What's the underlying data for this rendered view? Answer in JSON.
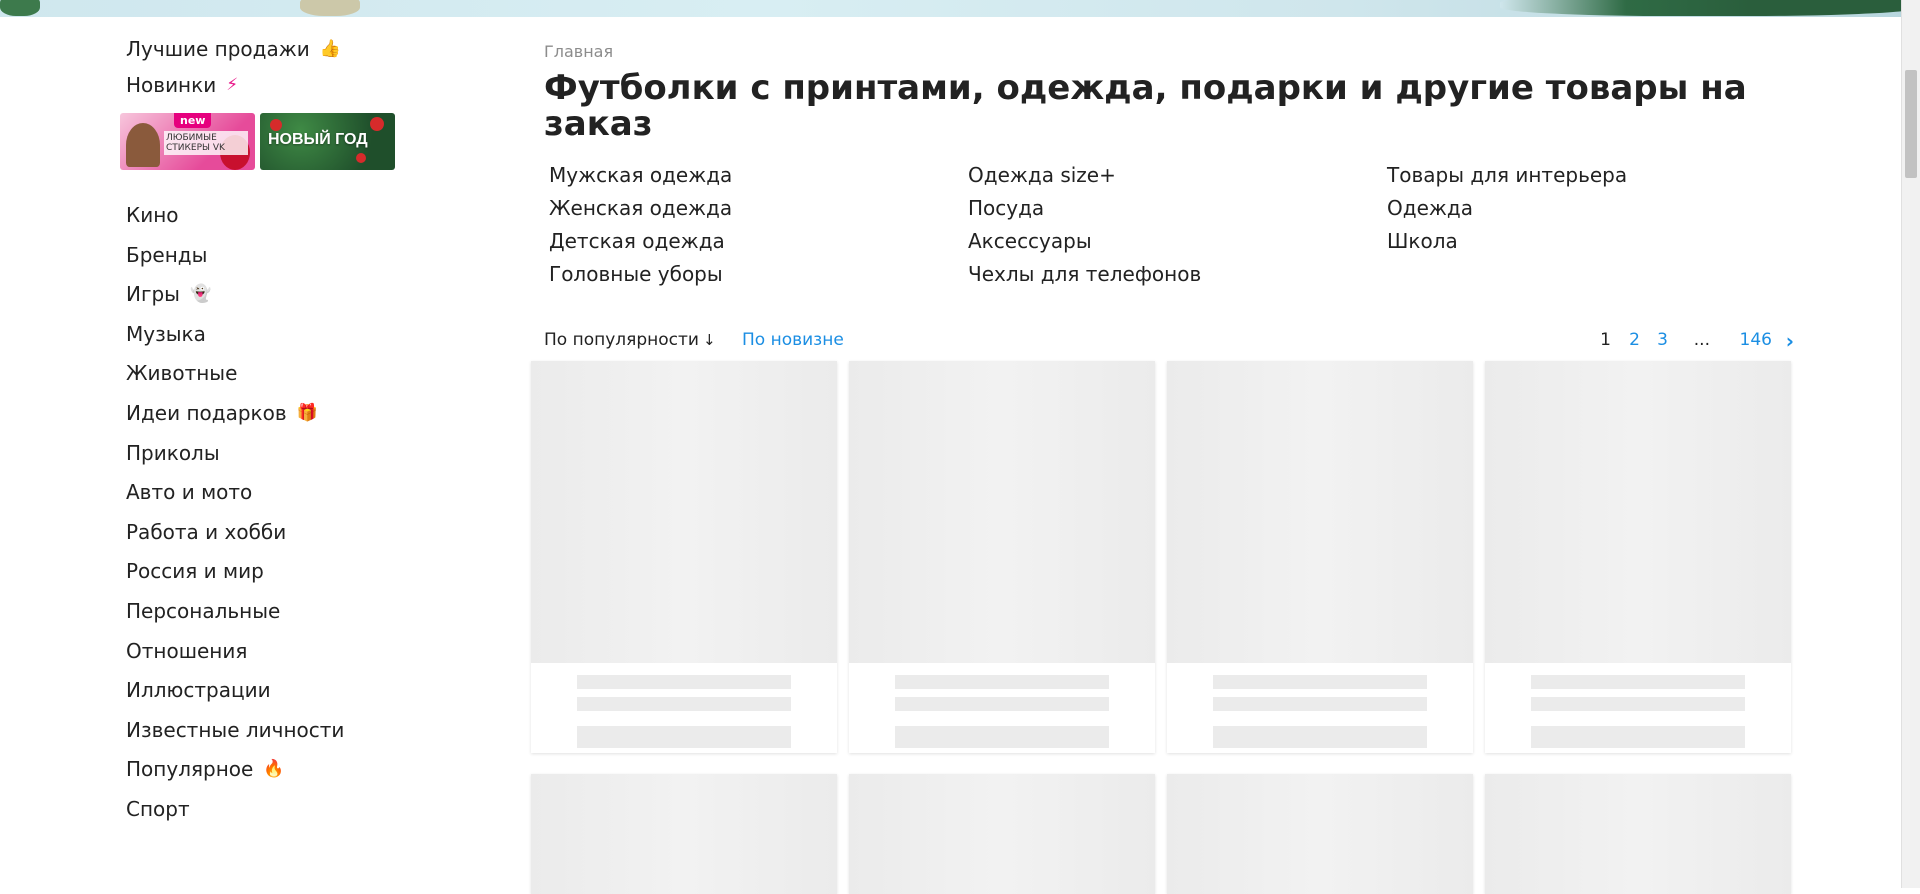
{
  "sidebar": {
    "top_items": [
      {
        "label": "Лучшие продажи",
        "emoji": "👍",
        "emoji_color": "#f28c18"
      },
      {
        "label": "Новинки",
        "emoji": "⚡",
        "emoji_color": "#e91e8c"
      }
    ],
    "promos": {
      "stickers": {
        "badge": "new",
        "text": "Любимые стикеры VK"
      },
      "new_year": {
        "text": "НОВЫЙ ГОД"
      }
    },
    "items": [
      {
        "label": "Кино",
        "emoji": ""
      },
      {
        "label": "Бренды",
        "emoji": ""
      },
      {
        "label": "Игры",
        "emoji": "👻",
        "emoji_color": "#29a9e0"
      },
      {
        "label": "Музыка",
        "emoji": ""
      },
      {
        "label": "Животные",
        "emoji": ""
      },
      {
        "label": "Идеи подарков",
        "emoji": "🎁",
        "emoji_color": "#29a9e0"
      },
      {
        "label": "Приколы",
        "emoji": ""
      },
      {
        "label": "Авто и мото",
        "emoji": ""
      },
      {
        "label": "Работа и хобби",
        "emoji": ""
      },
      {
        "label": "Россия и мир",
        "emoji": ""
      },
      {
        "label": "Персональные",
        "emoji": ""
      },
      {
        "label": "Отношения",
        "emoji": ""
      },
      {
        "label": "Иллюстрации",
        "emoji": ""
      },
      {
        "label": "Известные личности",
        "emoji": ""
      },
      {
        "label": "Популярное",
        "emoji": "🔥",
        "emoji_color": "#e91e63"
      },
      {
        "label": "Спорт",
        "emoji": ""
      }
    ]
  },
  "main": {
    "breadcrumb": "Главная",
    "title": "Футболки с принтами, одежда, подарки и другие товары на заказ",
    "categories": [
      [
        "Мужская одежда",
        "Женская одежда",
        "Детская одежда",
        "Головные уборы"
      ],
      [
        "Одежда size+",
        "Посуда",
        "Аксессуары",
        "Чехлы для телефонов"
      ],
      [
        "Товары для интерьера",
        "Одежда",
        "Школа"
      ]
    ],
    "sort": {
      "active": "По популярности",
      "alternative": "По новизне"
    },
    "pagination": {
      "pages": [
        "1",
        "2",
        "3"
      ],
      "ellipsis": "...",
      "last": "146",
      "current": "1"
    },
    "product_placeholders": 8
  },
  "colors": {
    "link": "#1b8ee3",
    "text": "#222222",
    "muted": "#8c8c8c",
    "placeholder": "#ebebeb"
  }
}
